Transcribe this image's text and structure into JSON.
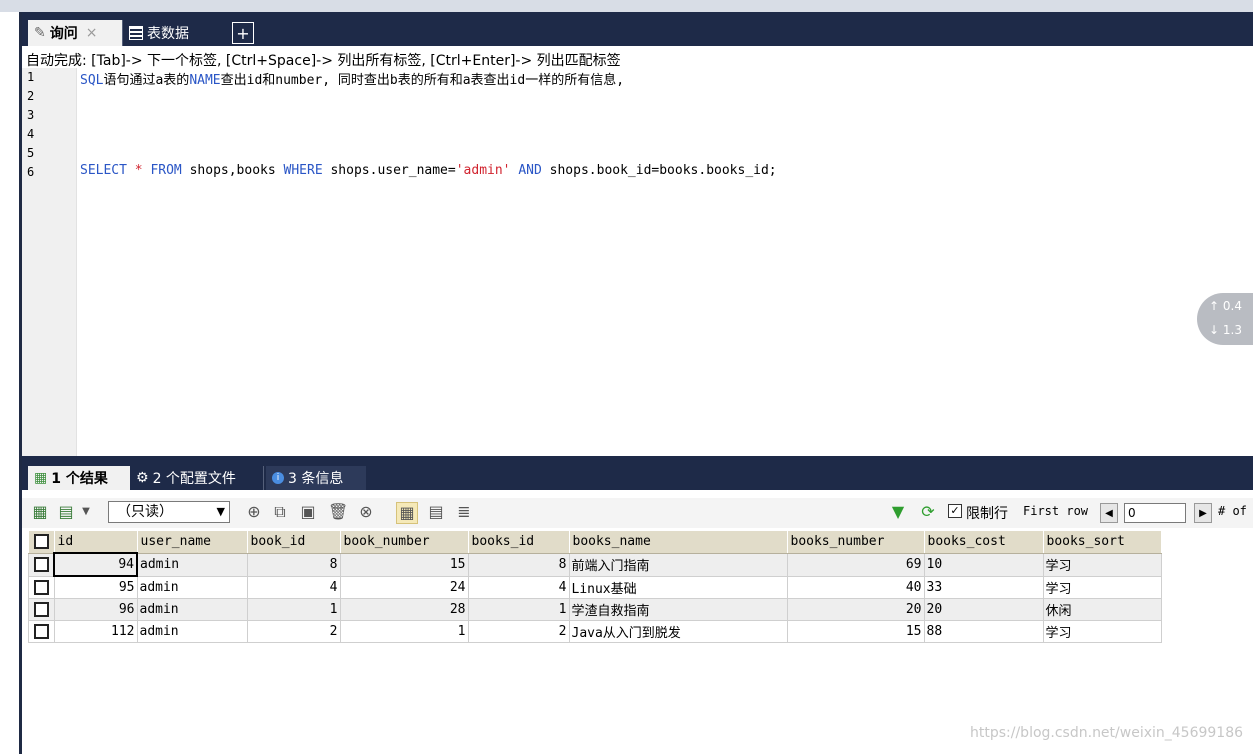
{
  "editor_tabs": [
    {
      "label": "询问",
      "active": true
    },
    {
      "label": "表数据",
      "active": false
    }
  ],
  "hint": "自动完成: [Tab]-> 下一个标签, [Ctrl+Space]-> 列出所有标签, [Ctrl+Enter]-> 列出匹配标签",
  "editor": {
    "line_numbers": [
      "1",
      "2",
      "3",
      "4",
      "5",
      "6"
    ],
    "line1": {
      "kw_sql": "SQL",
      "text_a": "语句通过a表的",
      "kw_name": "NAME",
      "text_b": "查出id和number, 同时查出b表的所有和a表查出id一样的所有信息,"
    },
    "line6": {
      "kw_select": "SELECT",
      "star": " * ",
      "kw_from": "FROM",
      "tables": " shops,books ",
      "kw_where": "WHERE",
      "cond1": " shops.user_name=",
      "str_admin": "'admin'",
      "kw_and": "AND",
      "cond2": " shops.book_id=books.books_id;"
    }
  },
  "speed_widget": {
    "up": "0.4",
    "down": "1.3"
  },
  "result_tabs": [
    {
      "label": "1 个结果"
    },
    {
      "label": "2 个配置文件"
    },
    {
      "label": "3 条信息"
    }
  ],
  "toolbar": {
    "mode": "（只读）",
    "limit_label": "限制行",
    "first_row_label": "First row",
    "first_row_value": "0",
    "rows_label": "# of"
  },
  "grid": {
    "columns": [
      "id",
      "user_name",
      "book_id",
      "book_number",
      "books_id",
      "books_name",
      "books_number",
      "books_cost",
      "books_sort"
    ],
    "rows": [
      [
        "94",
        "admin",
        "8",
        "15",
        "8",
        "前端入门指南",
        "69",
        "10",
        "学习"
      ],
      [
        "95",
        "admin",
        "4",
        "24",
        "4",
        "Linux基础",
        "40",
        "33",
        "学习"
      ],
      [
        "96",
        "admin",
        "1",
        "28",
        "1",
        "学渣自救指南",
        "20",
        "20",
        "休闲"
      ],
      [
        "112",
        "admin",
        "2",
        "1",
        "2",
        "Java从入门到脱发",
        "15",
        "88",
        "学习"
      ]
    ]
  },
  "watermark": "https://blog.csdn.net/weixin_45699186"
}
